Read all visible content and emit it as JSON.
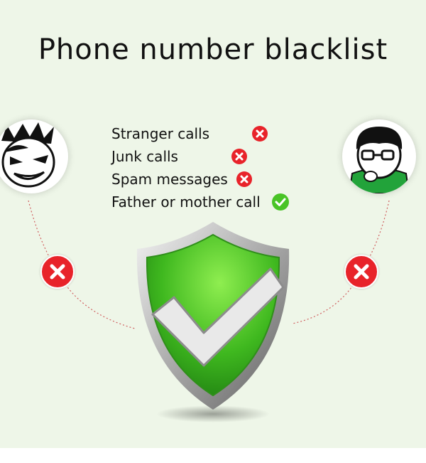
{
  "title": "Phone number blacklist",
  "items": [
    {
      "label": "Stranger calls",
      "status": "blocked",
      "icon": "red-x-icon"
    },
    {
      "label": "Junk calls",
      "status": "blocked",
      "icon": "red-x-icon"
    },
    {
      "label": "Spam messages",
      "status": "blocked",
      "icon": "red-x-icon"
    },
    {
      "label": "Father or mother call",
      "status": "allowed",
      "icon": "green-check-icon"
    }
  ],
  "colors": {
    "background": "#eef6e8",
    "block_red": "#e8232a",
    "allow_green": "#49c426",
    "shield_green": "#3fb81f"
  }
}
